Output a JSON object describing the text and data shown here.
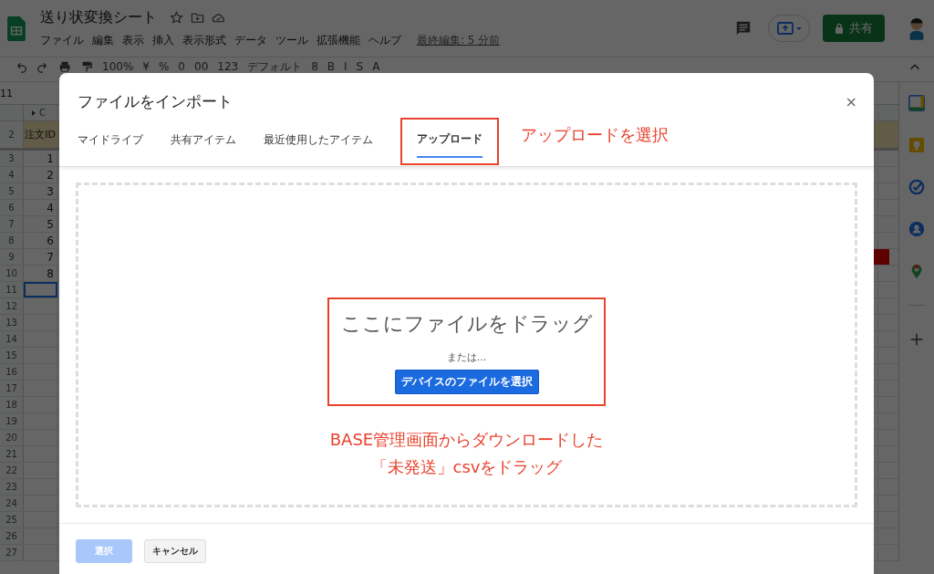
{
  "app": {
    "title": "送り状変換シート",
    "menu": [
      "ファイル",
      "編集",
      "表示",
      "挿入",
      "表示形式",
      "データ",
      "ツール",
      "拡張機能",
      "ヘルプ"
    ],
    "last_edit": "最終編集: 5 分前",
    "share_button": "共有"
  },
  "toolbar": [
    "100%",
    "¥",
    "%",
    "0",
    "00",
    "123",
    "デフォルト",
    "8",
    "B",
    "I",
    "S",
    "A"
  ],
  "name_box": "11",
  "sheet": {
    "column_header": "C",
    "header_row": {
      "number": "2",
      "value": "注文ID"
    },
    "rows": [
      {
        "number": "3",
        "value": "1",
        "selected": false,
        "marked": false
      },
      {
        "number": "4",
        "value": "2",
        "selected": false,
        "marked": false
      },
      {
        "number": "5",
        "value": "3",
        "selected": false,
        "marked": false
      },
      {
        "number": "6",
        "value": "4",
        "selected": false,
        "marked": false
      },
      {
        "number": "7",
        "value": "5",
        "selected": false,
        "marked": false
      },
      {
        "number": "8",
        "value": "6",
        "selected": false,
        "marked": false
      },
      {
        "number": "9",
        "value": "7",
        "selected": false,
        "marked": true
      },
      {
        "number": "10",
        "value": "8",
        "selected": false,
        "marked": false
      },
      {
        "number": "11",
        "selected": true,
        "marked": false
      },
      {
        "number": "12",
        "selected": false,
        "marked": false
      },
      {
        "number": "13",
        "selected": false,
        "marked": false
      },
      {
        "number": "14",
        "selected": false,
        "marked": false
      },
      {
        "number": "15",
        "selected": false,
        "marked": false
      },
      {
        "number": "16",
        "selected": false,
        "marked": false
      },
      {
        "number": "17",
        "selected": false,
        "marked": false
      },
      {
        "number": "18",
        "selected": false,
        "marked": false
      },
      {
        "number": "19",
        "selected": false,
        "marked": false
      },
      {
        "number": "20",
        "selected": false,
        "marked": false
      },
      {
        "number": "21",
        "selected": false,
        "marked": false
      },
      {
        "number": "22",
        "selected": false,
        "marked": false
      },
      {
        "number": "23",
        "selected": false,
        "marked": false
      },
      {
        "number": "24",
        "selected": false,
        "marked": false
      },
      {
        "number": "25",
        "selected": false,
        "marked": false
      },
      {
        "number": "26",
        "selected": false,
        "marked": false
      },
      {
        "number": "27",
        "selected": false,
        "marked": false
      }
    ]
  },
  "dialog": {
    "title": "ファイルをインポート",
    "close": "×",
    "tabs": [
      {
        "label": "マイドライブ",
        "selected": false
      },
      {
        "label": "共有アイテム",
        "selected": false
      },
      {
        "label": "最近使用したアイテム",
        "selected": false
      },
      {
        "label": "アップロード",
        "selected": true
      }
    ],
    "drop_text": "ここにファイルをドラッグ",
    "or_text": "または...",
    "browse_button": "デバイスのファイルを選択",
    "buttons": [
      {
        "label": "選択",
        "disabled": true
      },
      {
        "label": "キャンセル",
        "disabled": false
      }
    ]
  },
  "annotations": {
    "tab_note": "アップロードを選択",
    "drop_note": [
      "BASE管理画面からダウンロードした",
      "「未発送」csvをドラッグ"
    ]
  }
}
